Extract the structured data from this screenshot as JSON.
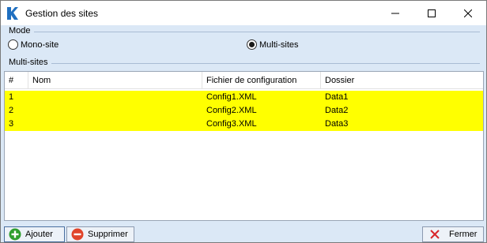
{
  "window": {
    "title": "Gestion des sites"
  },
  "mode": {
    "label": "Mode",
    "options": [
      {
        "label": "Mono-site",
        "selected": false
      },
      {
        "label": "Multi-sites",
        "selected": true
      }
    ]
  },
  "multisites": {
    "label": "Multi-sites",
    "columns": [
      "#",
      "Nom",
      "Fichier de configuration",
      "Dossier"
    ],
    "rows": [
      {
        "num": "1",
        "nom": "",
        "fichier": "Config1.XML",
        "dossier": "Data1"
      },
      {
        "num": "2",
        "nom": "",
        "fichier": "Config2.XML",
        "dossier": "Data2"
      },
      {
        "num": "3",
        "nom": "",
        "fichier": "Config3.XML",
        "dossier": "Data3"
      }
    ],
    "row_highlight_color": "#ffff00"
  },
  "buttons": {
    "add": "Ajouter",
    "delete": "Supprimer",
    "close": "Fermer"
  },
  "icons": {
    "logo": "app-k-logo-icon",
    "add": "green-plus-icon",
    "delete": "red-minus-icon",
    "close": "red-x-icon"
  }
}
